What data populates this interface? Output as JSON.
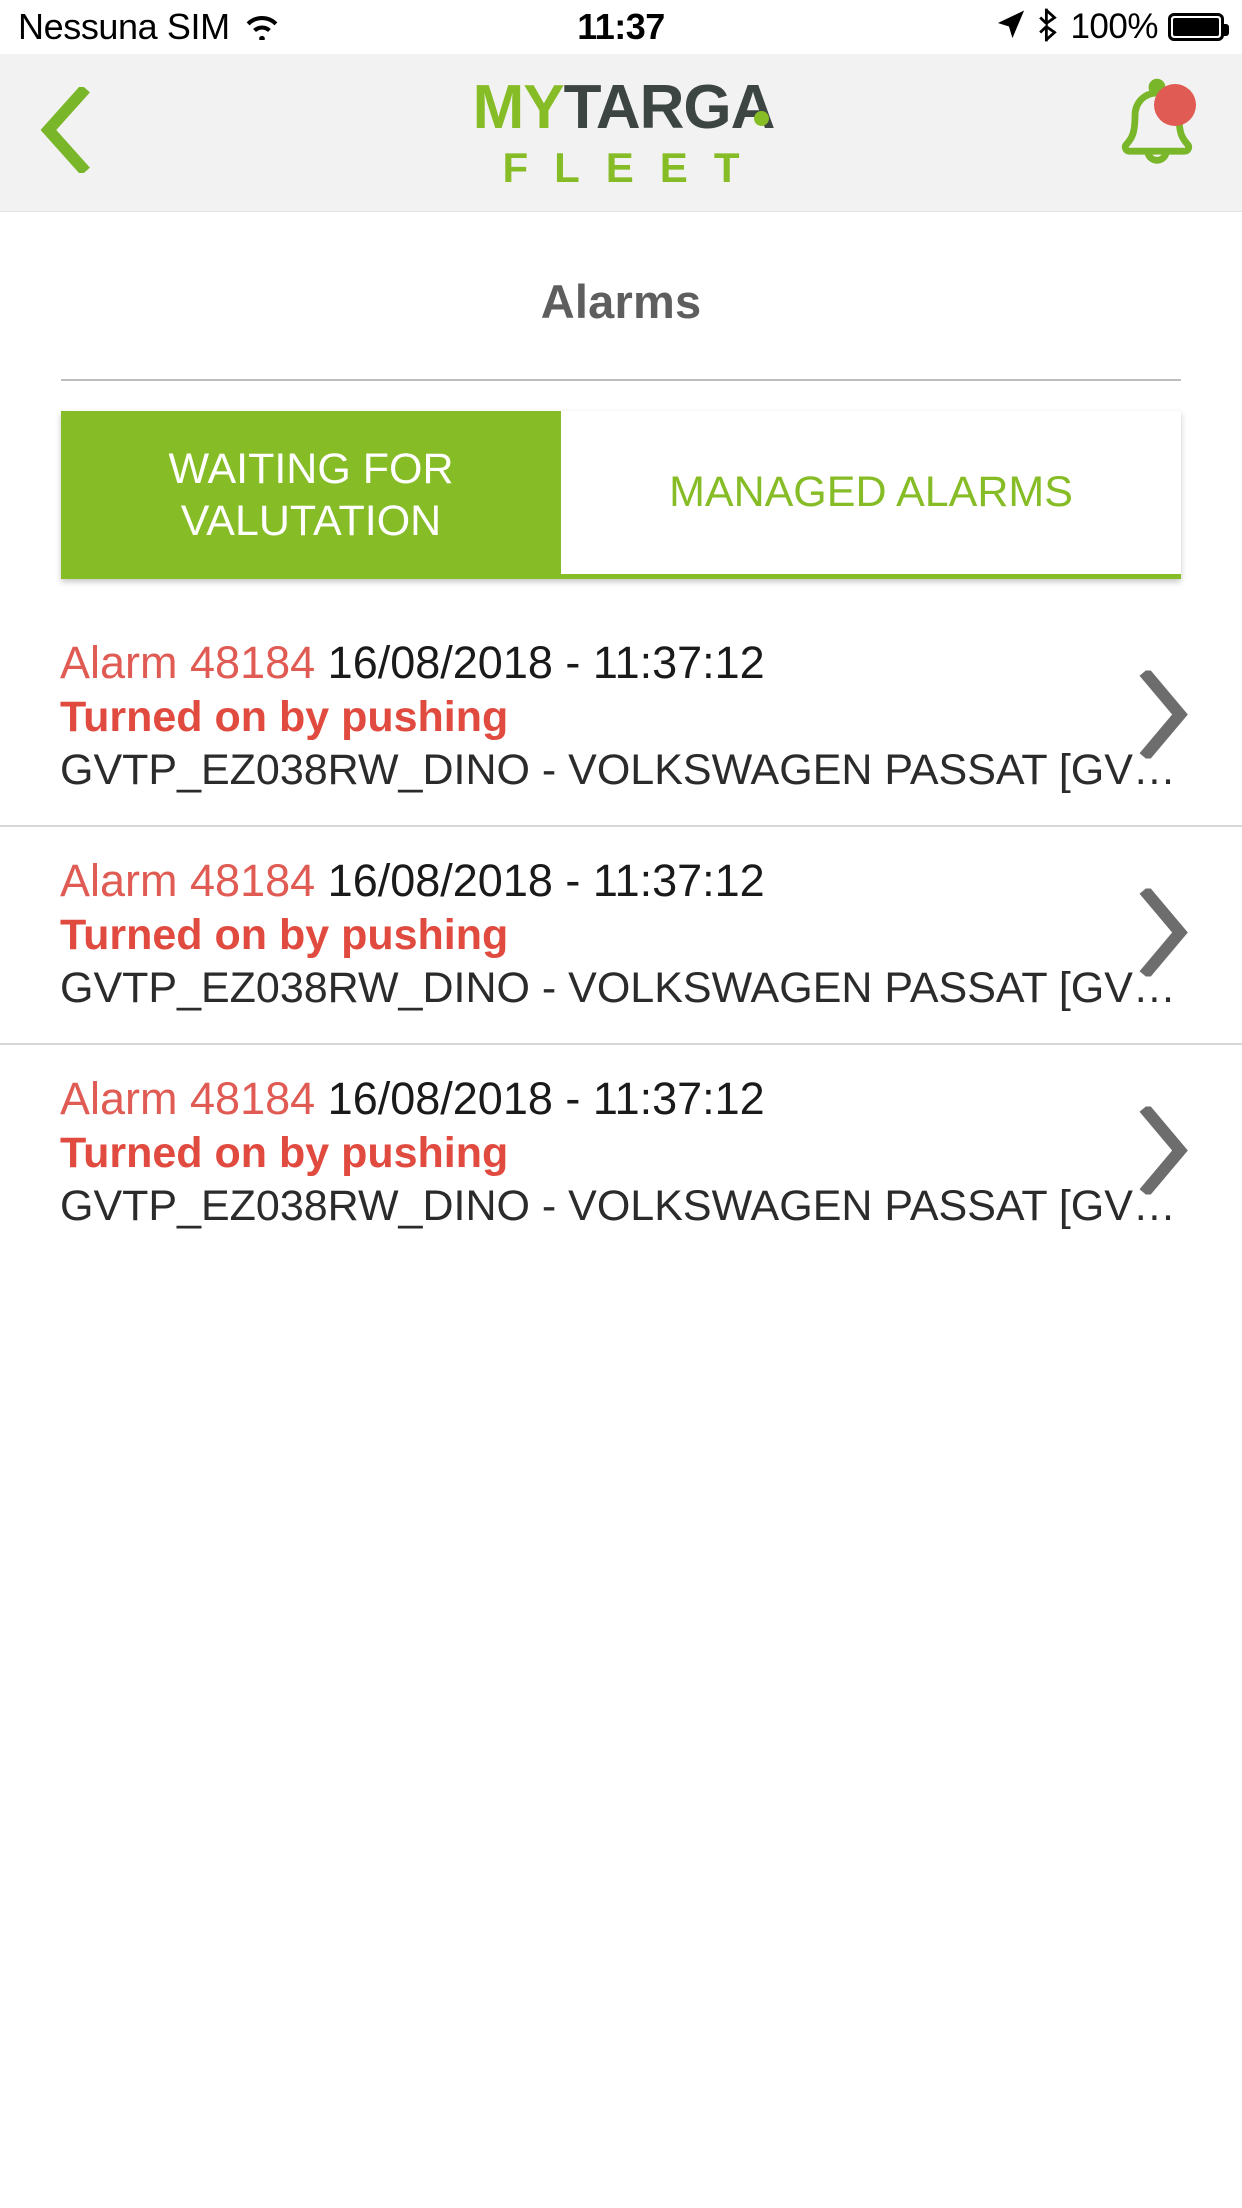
{
  "status_bar": {
    "carrier": "Nessuna SIM",
    "wifi_icon": "wifi-icon",
    "time": "11:37",
    "location_icon": "location-arrow-icon",
    "bluetooth_icon": "bluetooth-icon",
    "battery_percent": "100%"
  },
  "header": {
    "back_icon": "chevron-left-icon",
    "logo_part1": "MY",
    "logo_part2": "TARGA",
    "logo_subtitle": "FLEET",
    "bell_icon": "bell-icon",
    "badge_visible": true,
    "colors": {
      "brand_green": "#86bc25",
      "brand_dark": "#3d4543",
      "badge_red": "#e05b53",
      "header_bg": "#f2f2f2"
    }
  },
  "page": {
    "title": "Alarms"
  },
  "tabs": [
    {
      "label": "WAITING FOR VALUTATION",
      "active": true
    },
    {
      "label": "MANAGED ALARMS",
      "active": false
    }
  ],
  "alarms": [
    {
      "id_label": "Alarm 48184",
      "datetime": "16/08/2018 - 11:37:12",
      "reason": "Turned on by pushing",
      "vehicle": "GVTP_EZ038RW_DINO - VOLKSWAGEN PASSAT [GV…",
      "chevron_icon": "chevron-right-icon"
    },
    {
      "id_label": "Alarm 48184",
      "datetime": "16/08/2018 - 11:37:12",
      "reason": "Turned on by pushing",
      "vehicle": "GVTP_EZ038RW_DINO - VOLKSWAGEN PASSAT [GV…",
      "chevron_icon": "chevron-right-icon"
    },
    {
      "id_label": "Alarm 48184",
      "datetime": "16/08/2018 - 11:37:12",
      "reason": "Turned on by pushing",
      "vehicle": "GVTP_EZ038RW_DINO - VOLKSWAGEN PASSAT [GV…",
      "chevron_icon": "chevron-right-icon"
    }
  ]
}
